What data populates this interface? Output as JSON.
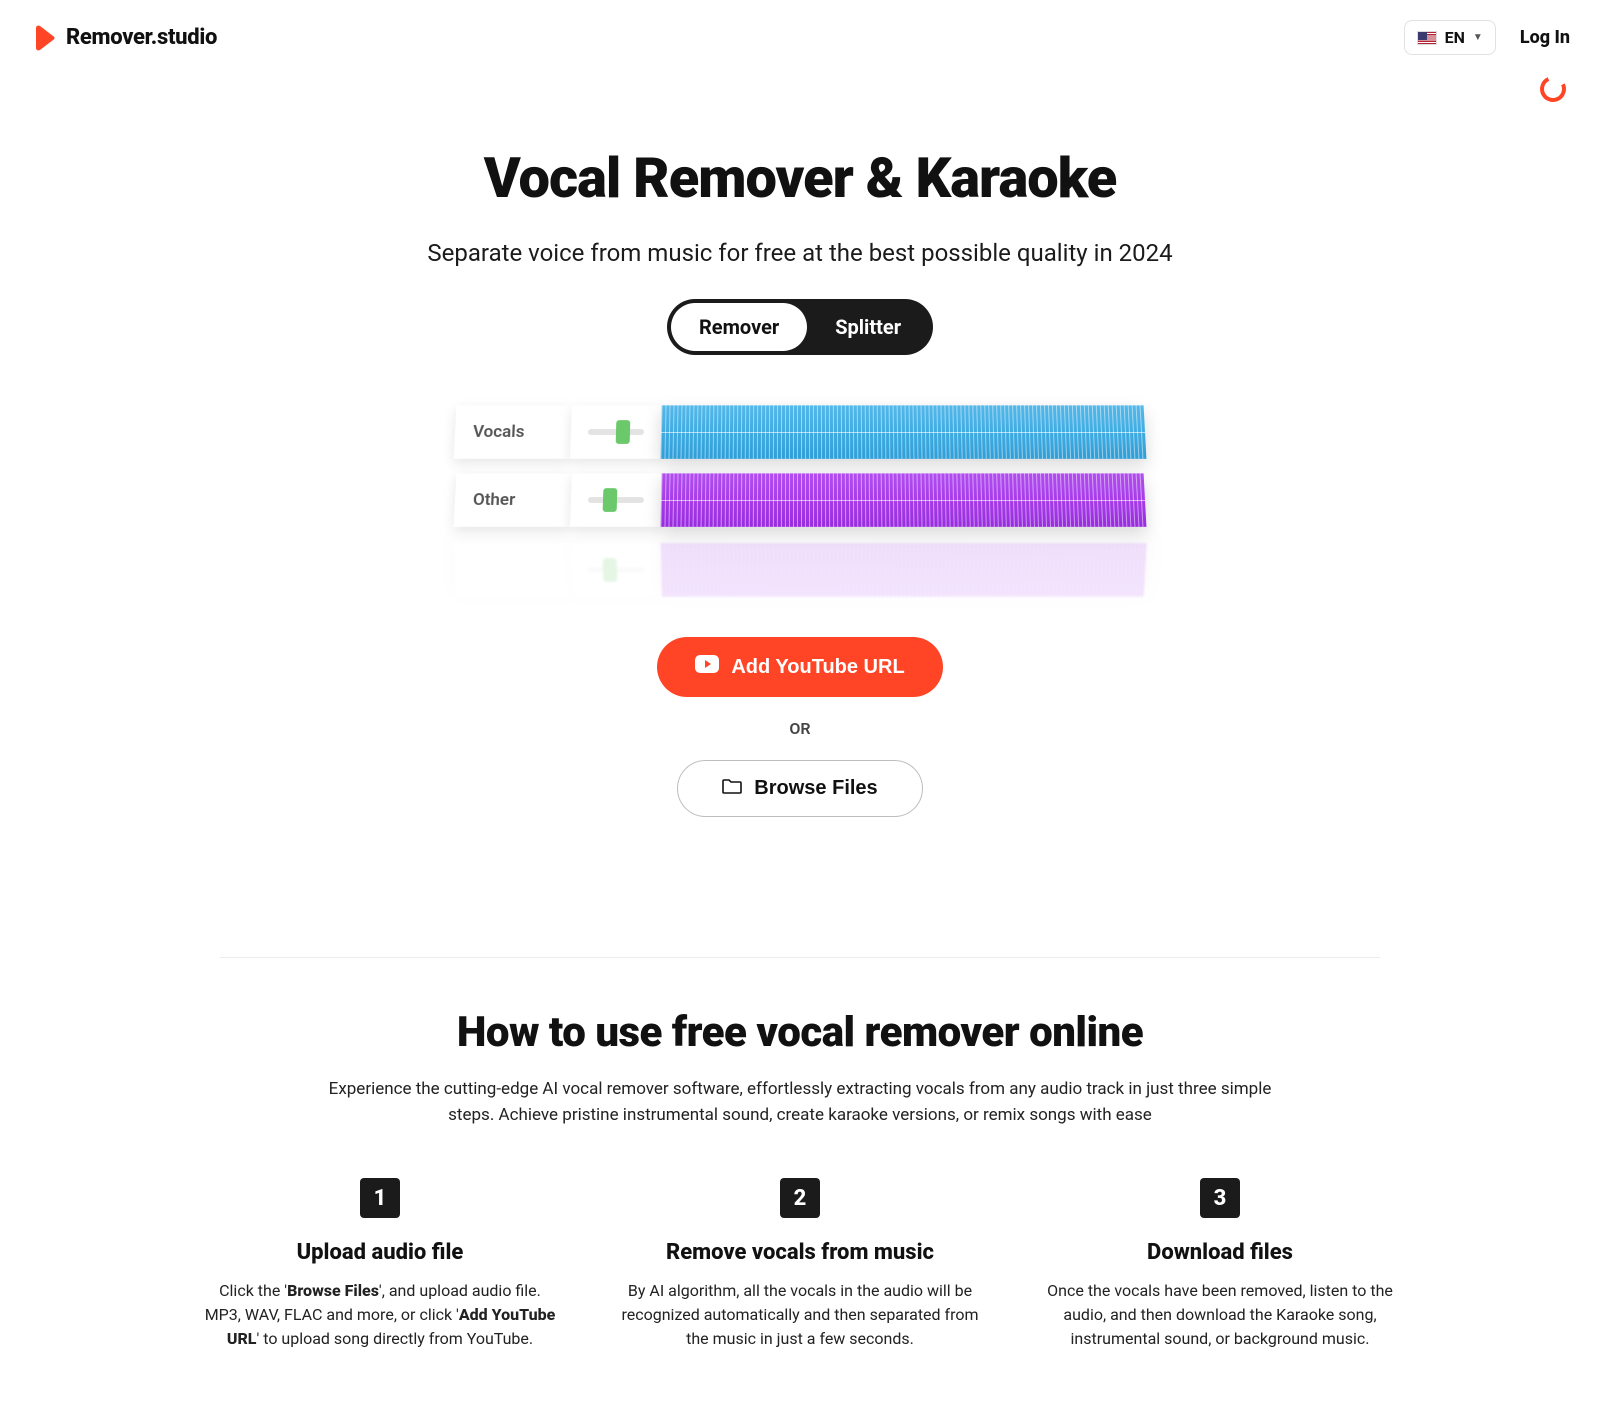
{
  "brand": {
    "name": "Remover.studio"
  },
  "header": {
    "lang": "EN",
    "login": "Log In"
  },
  "hero": {
    "title": "Vocal Remover & Karaoke",
    "subtitle": "Separate voice from music for free at the best possible quality in 2024",
    "tab_remover": "Remover",
    "tab_splitter": "Splitter"
  },
  "tracks": {
    "vocals": "Vocals",
    "other": "Other"
  },
  "cta": {
    "youtube": "Add YouTube URL",
    "or": "OR",
    "browse": "Browse Files"
  },
  "howto": {
    "title": "How to use free vocal remover online",
    "subtitle": "Experience the cutting-edge AI vocal remover software, effortlessly extracting vocals from any audio track in just three simple steps. Achieve pristine instrumental sound, create karaoke versions, or remix songs with ease",
    "steps": [
      {
        "num": "1",
        "title": "Upload audio file",
        "pre": "Click the '",
        "bold1": "Browse Files",
        "mid": "', and upload audio file. MP3, WAV, FLAC and more, or click '",
        "bold2": "Add YouTube URL",
        "post": "' to upload song directly from YouTube."
      },
      {
        "num": "2",
        "title": "Remove vocals from music",
        "body": "By AI algorithm, all the vocals in the audio will be recognized automatically and then separated from the music in just a few seconds."
      },
      {
        "num": "3",
        "title": "Download files",
        "body": "Once the vocals have been removed, listen to the audio, and then download the Karaoke song, instrumental sound, or background music."
      }
    ]
  }
}
